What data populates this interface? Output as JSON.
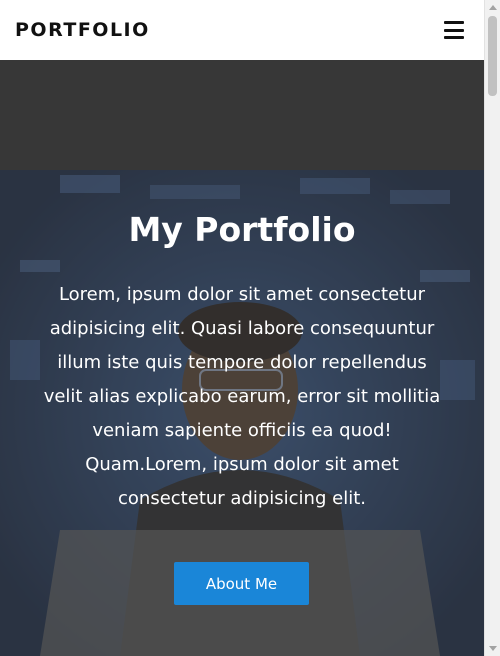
{
  "navbar": {
    "brand": "PORTFOLIO",
    "menu_icon": "hamburger-menu-icon"
  },
  "hero": {
    "title": "My Portfolio",
    "text": "Lorem, ipsum dolor sit amet consectetur adipisicing elit. Quasi labore consequuntur illum iste quis tempore dolor repellendus velit alias explicabo earum, error sit mollitia veniam sapiente officiis ea quod! Quam.Lorem, ipsum dolor sit amet consectetur adipisicing elit.",
    "button_label": "About Me",
    "background_image": "person-with-glasses-at-laptop-photo"
  },
  "colors": {
    "button": "#1a86d8",
    "navbar_bg": "#ffffff",
    "brand_text": "#111111",
    "hero_text": "#ffffff"
  }
}
